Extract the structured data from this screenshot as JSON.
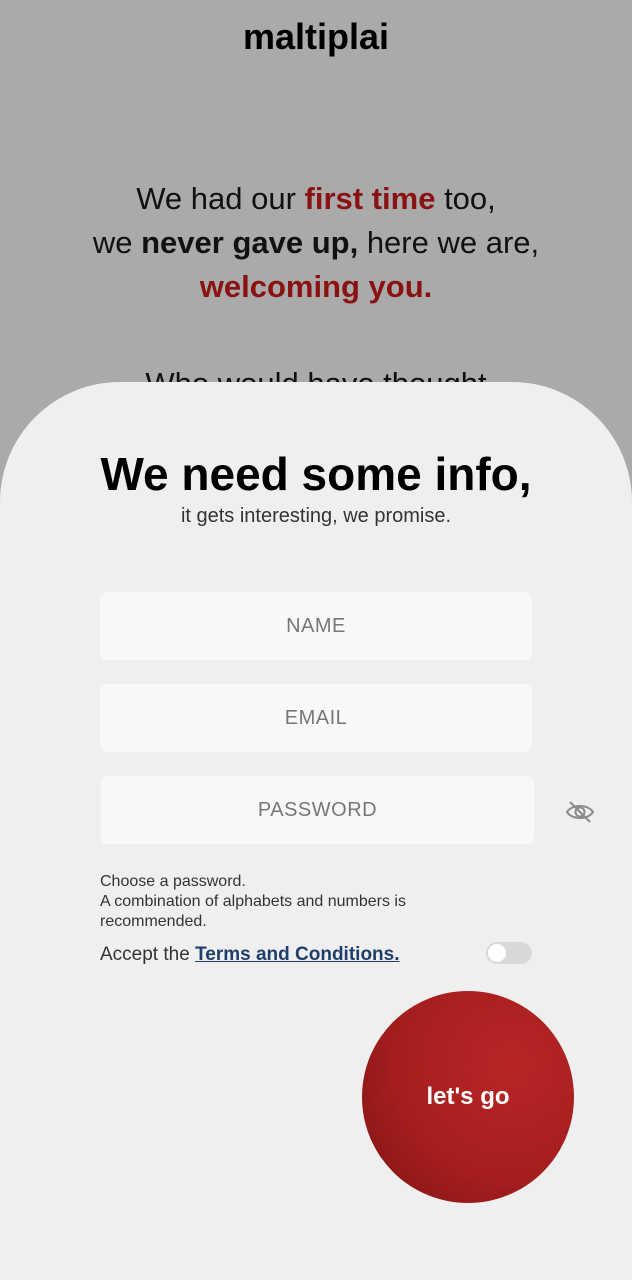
{
  "app": {
    "title": "maltiplai"
  },
  "welcome": {
    "l1_a": "We had our ",
    "l1_b": "first time",
    "l1_c": " too,",
    "l2_a": "we ",
    "l2_b": "never gave up,",
    "l2_c": " here we are,",
    "l3": "welcoming you.",
    "teaser": "Who would have thought"
  },
  "form": {
    "heading": "We need some info,",
    "subheading": "it gets interesting, we promise.",
    "name_placeholder": "NAME",
    "email_placeholder": "EMAIL",
    "password_placeholder": "PASSWORD",
    "password_hint_1": "Choose a password.",
    "password_hint_2": "A combination of alphabets and numbers is recommended.",
    "terms_prefix": "Accept the ",
    "terms_link": "Terms and Conditions.",
    "submit_label": "let's go",
    "visibility_icon": "eye-off-icon"
  },
  "colors": {
    "accent": "#8a1212",
    "link": "#1f3f6b",
    "background": "#aaaaaa",
    "sheet": "#efefef"
  }
}
